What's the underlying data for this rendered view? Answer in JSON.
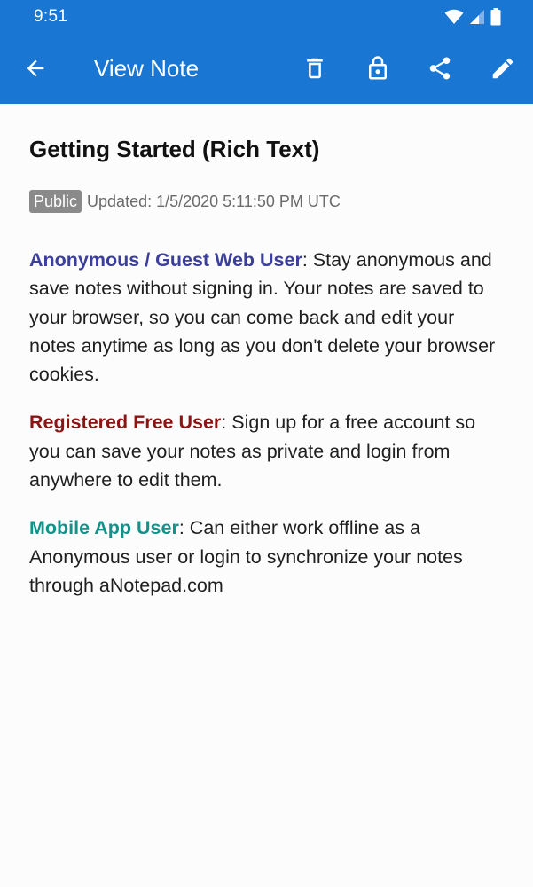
{
  "status_bar": {
    "time": "9:51"
  },
  "app_bar": {
    "title": "View Note",
    "background": "#1976d2",
    "actions": [
      "arrow-back-icon",
      "trash-icon",
      "lock-icon",
      "share-icon",
      "pencil-icon"
    ]
  },
  "note": {
    "title": "Getting Started (Rich Text)",
    "visibility_badge": "Public",
    "updated": "Updated: 1/5/2020 5:11:50 PM UTC",
    "paragraphs": [
      {
        "lead": "Anonymous / Guest Web User",
        "lead_color": "#3b3f9b",
        "body": ": Stay anonymous and save notes without signing in. Your notes are saved to your browser, so you can come back and edit your notes anytime as long as you don't delete your browser cookies."
      },
      {
        "lead": "Registered Free User",
        "lead_color": "#8b1414",
        "body": ": Sign up for a free account so you can save your notes as private and login from anywhere to edit them."
      },
      {
        "lead": "Mobile App User",
        "lead_color": "#129288",
        "body": ": Can either work offline as a Anonymous user or login to synchronize your notes through aNotepad.com"
      }
    ]
  }
}
